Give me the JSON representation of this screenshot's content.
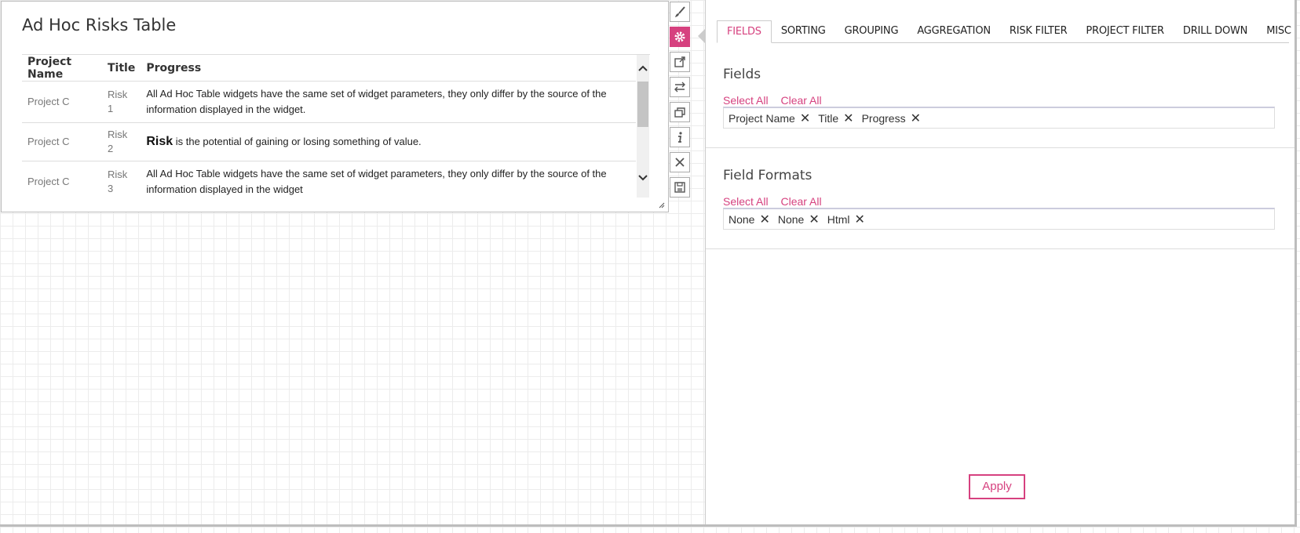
{
  "widget": {
    "title": "Ad Hoc Risks Table",
    "columns": [
      "Project Name",
      "Title",
      "Progress"
    ],
    "rows": [
      {
        "project": "Project C",
        "title": "Risk 1",
        "progress": "All Ad Hoc Table widgets have the same set of widget parameters, they only differ by the source of the information displayed in the widget."
      },
      {
        "project": "Project C",
        "title": "Risk 2",
        "progress_bold": "Risk",
        "progress": " is the potential of gaining or losing something of value."
      },
      {
        "project": "Project C",
        "title": "Risk 3",
        "progress": "All Ad Hoc Table widgets have the same set of widget parameters, they only differ by the source of the information displayed in the widget"
      }
    ]
  },
  "toolbar": [
    "brush-icon",
    "gear-icon",
    "external-link-icon",
    "swap-icon",
    "copy-icon",
    "info-icon",
    "close-icon",
    "save-icon"
  ],
  "panel": {
    "tabs": [
      "FIELDS",
      "SORTING",
      "GROUPING",
      "AGGREGATION",
      "RISK FILTER",
      "PROJECT FILTER",
      "DRILL DOWN",
      "MISC"
    ],
    "active_tab": "FIELDS",
    "fields": {
      "heading": "Fields",
      "select_all": "Select All",
      "clear_all": "Clear All",
      "tags": [
        "Project Name",
        "Title",
        "Progress"
      ]
    },
    "formats": {
      "heading": "Field Formats",
      "select_all": "Select All",
      "clear_all": "Clear All",
      "tags": [
        "None",
        "None",
        "Html"
      ]
    },
    "apply_label": "Apply"
  },
  "colors": {
    "accent": "#d6417f"
  }
}
